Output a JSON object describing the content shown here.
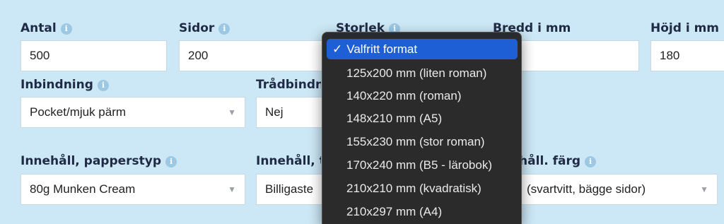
{
  "labels": {
    "antal": "Antal",
    "sidor": "Sidor",
    "storlek": "Storlek",
    "bredd": "Bredd i mm",
    "hojd": "Höjd i mm",
    "inbindning": "Inbindning",
    "tradbindning": "Trådbindning",
    "papperstyp": "Innehåll, papperstyp",
    "innehall_t": "Innehåll, t",
    "farg": "Innehåll. färg"
  },
  "info_glyph": "i",
  "fields": {
    "antal": "500",
    "sidor": "200",
    "hojd": "180",
    "inbindning": "Pocket/mjuk pärm",
    "tradbindning": "Nej",
    "papperstyp": "80g Munken Cream",
    "innehall_t": "Billigaste",
    "farg": "(svartvitt, bägge sidor)"
  },
  "caret_glyph": "▼",
  "dropdown": {
    "check": "✓",
    "options": [
      "Valfritt format",
      "125x200 mm (liten roman)",
      "140x220 mm (roman)",
      "148x210 mm (A5)",
      "155x230 mm (stor roman)",
      "170x240 mm (B5 - lärobok)",
      "210x210 mm (kvadratisk)",
      "210x297 mm (A4)"
    ],
    "selected_index": 0
  },
  "colors": {
    "background": "#cce7f5",
    "info_icon": "#9cc8e4",
    "dropdown_bg": "#2b2b2b",
    "dropdown_selected": "#1f5fd6"
  }
}
